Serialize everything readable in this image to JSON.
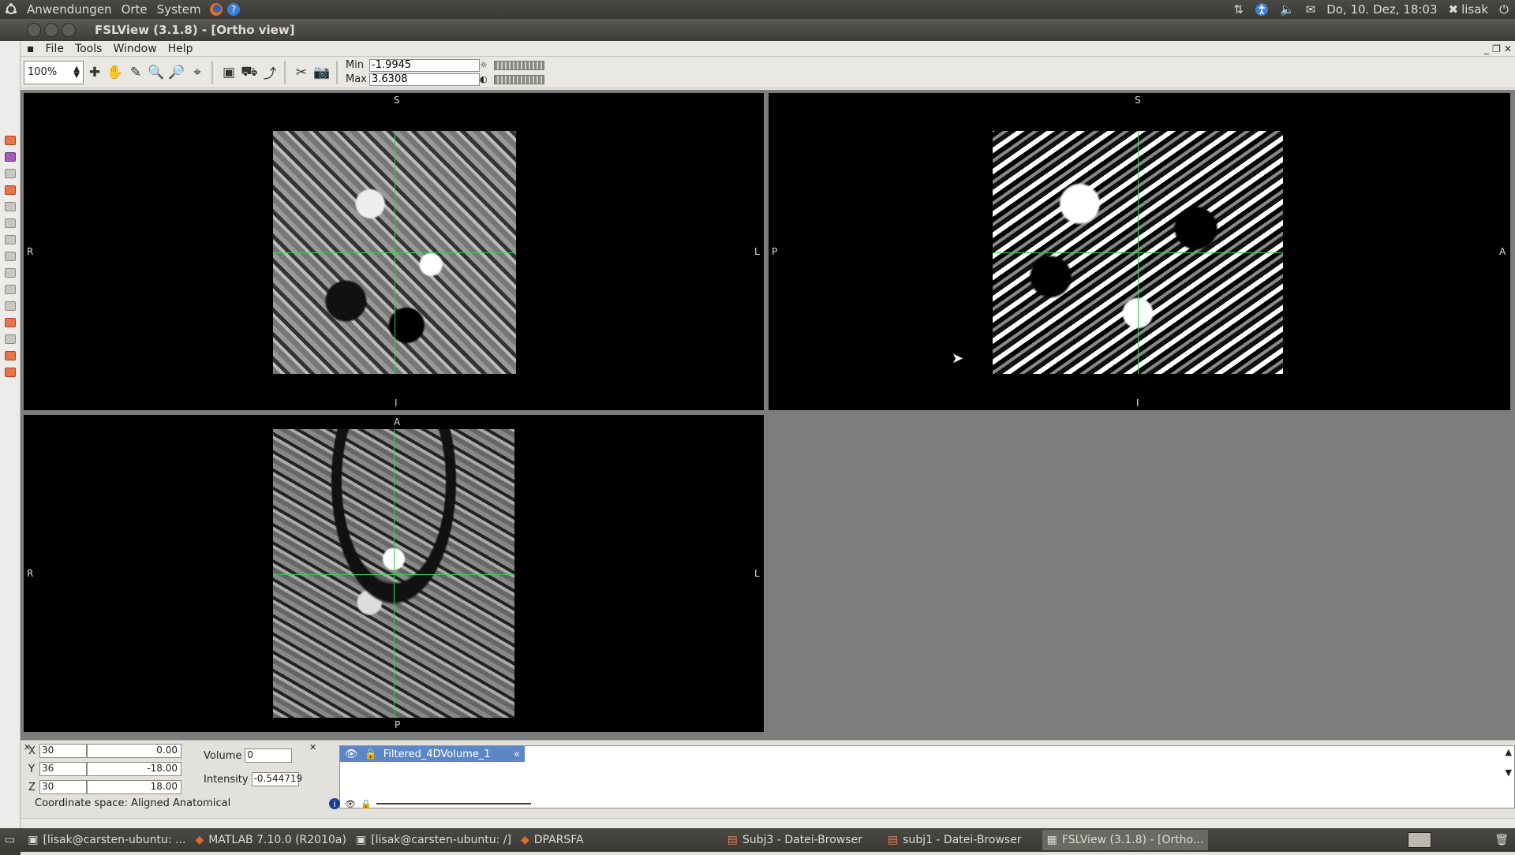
{
  "top_panel": {
    "menus": [
      "Anwendungen",
      "Orte",
      "System"
    ],
    "datetime": "Do, 10. Dez, 18:03",
    "user": "lisak"
  },
  "window": {
    "title": "FSLView (3.1.8) - [Ortho view]"
  },
  "menu": {
    "items": [
      "File",
      "Tools",
      "Window",
      "Help"
    ]
  },
  "toolbar": {
    "zoom": "100%",
    "min_label": "Min",
    "min_value": "-1.9945",
    "max_label": "Max",
    "max_value": "3.6308"
  },
  "views": {
    "coronal": {
      "top": "S",
      "bottom": "I",
      "left": "R",
      "right": "L"
    },
    "sagittal": {
      "top": "S",
      "bottom": "I",
      "left": "P",
      "right": "A"
    },
    "axial": {
      "top": "A",
      "bottom": "P",
      "left": "R",
      "right": "L"
    }
  },
  "coords": {
    "x_label": "X",
    "x_voxel": "30",
    "x_mm": "0.00",
    "y_label": "Y",
    "y_voxel": "36",
    "y_mm": "-18.00",
    "z_label": "Z",
    "z_voxel": "30",
    "z_mm": "18.00",
    "volume_label": "Volume",
    "volume_value": "0",
    "intensity_label": "Intensity",
    "intensity_value": "-0.544719",
    "space": "Coordinate space: Aligned Anatomical"
  },
  "layers": {
    "name": "Filtered_4DVolume_1"
  },
  "taskbar": [
    {
      "label": "[lisak@carsten-ubuntu: ...",
      "icon": "terminal-icon"
    },
    {
      "label": "MATLAB  7.10.0 (R2010a)",
      "icon": "matlab-icon"
    },
    {
      "label": "[lisak@carsten-ubuntu: /]",
      "icon": "terminal-icon"
    },
    {
      "label": "DPARSFA",
      "icon": "matlab-icon"
    },
    {
      "label": "Subj3 - Datei-Browser",
      "icon": "folder-icon"
    },
    {
      "label": "subj1 - Datei-Browser",
      "icon": "folder-icon"
    },
    {
      "label": "FSLView (3.1.8) - [Ortho...",
      "icon": "fslview-icon",
      "active": true
    }
  ]
}
